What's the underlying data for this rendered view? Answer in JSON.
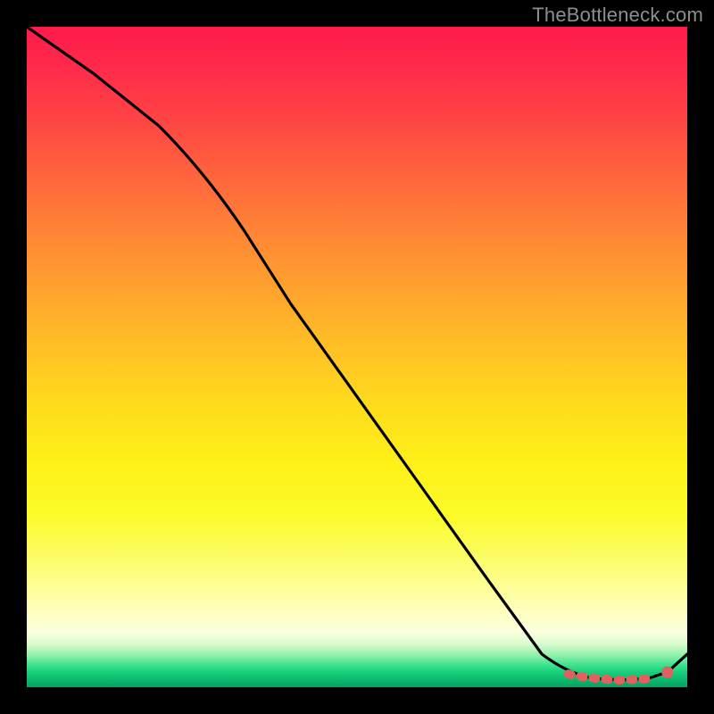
{
  "watermark": "TheBottleneck.com",
  "chart_data": {
    "type": "line",
    "title": "",
    "xlabel": "",
    "ylabel": "",
    "xlim": [
      0,
      100
    ],
    "ylim": [
      0,
      100
    ],
    "series": [
      {
        "name": "curve",
        "x": [
          0,
          10,
          20,
          27,
          33,
          40,
          50,
          60,
          70,
          78,
          82,
          86,
          90,
          94,
          97,
          100
        ],
        "y": [
          100,
          93,
          85,
          78,
          69,
          58,
          44,
          30,
          16,
          5,
          2,
          1.3,
          1.1,
          1.3,
          2.3,
          5
        ]
      }
    ],
    "markers": [
      {
        "name": "dashed-segment",
        "x": [
          82,
          94
        ],
        "y": [
          2,
          1.3
        ]
      },
      {
        "name": "end-dot",
        "x": 97,
        "y": 2.3
      }
    ],
    "colors": {
      "curve": "#000000",
      "dashed": "#e0615f",
      "dot": "#e0615f",
      "gradient_top": "#ff1a4b",
      "gradient_bottom": "#07a261"
    }
  }
}
